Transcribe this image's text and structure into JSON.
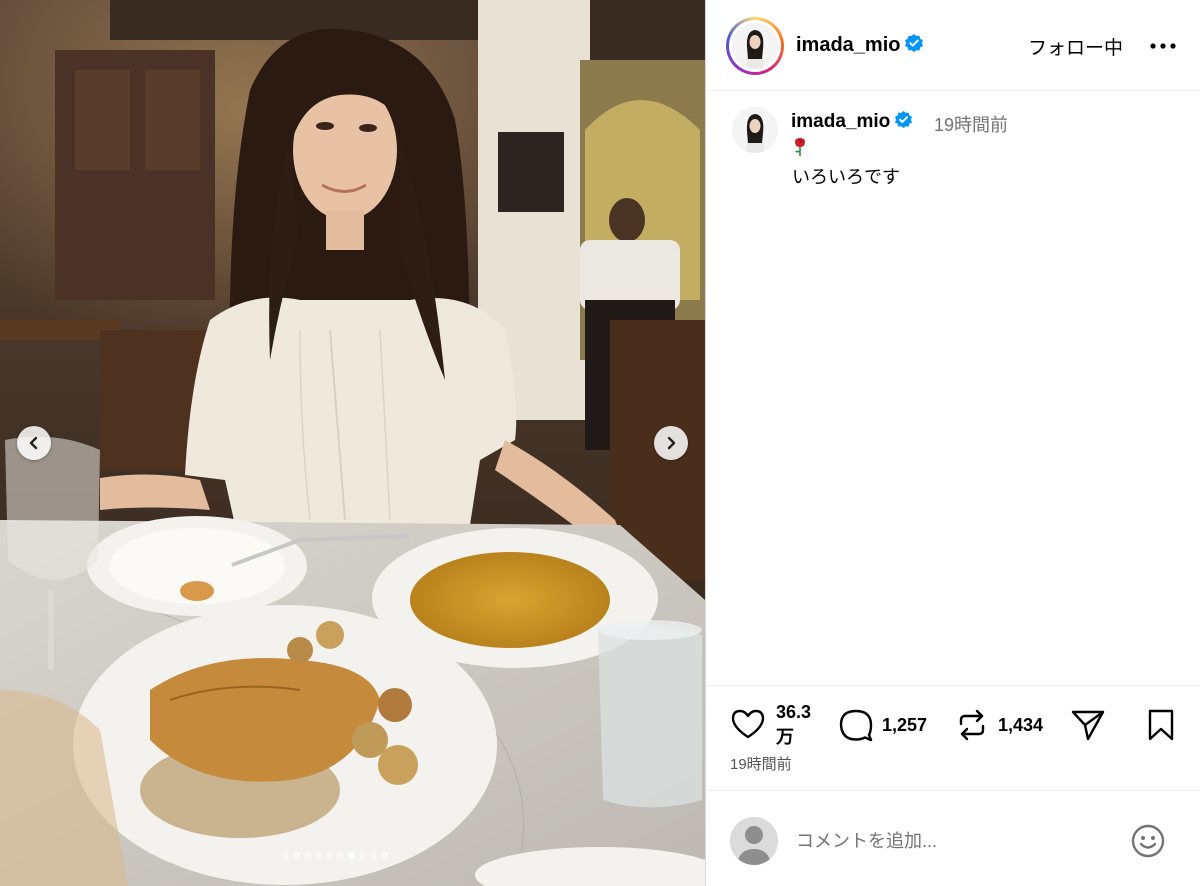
{
  "post": {
    "username": "imada_mio",
    "follow_label": "フォロー中",
    "caption_username": "imada_mio",
    "caption_time": "19時間前",
    "caption_emoji": "rose-icon",
    "caption_text": "いろいろです",
    "likes": "36.3",
    "likes_unit": "万",
    "comments": "1,257",
    "reposts": "1,434",
    "post_time": "19時間前",
    "comment_placeholder": "コメントを追加...",
    "carousel_total": 10,
    "carousel_active": 7
  },
  "colors": {
    "verified": "#0095f6",
    "secondary_text": "#737373",
    "border": "#dbdbdb"
  },
  "icons": [
    "more-icon",
    "heart-icon",
    "comment-icon",
    "repost-icon",
    "share-icon",
    "bookmark-icon",
    "emoji-icon",
    "chevron-left-icon",
    "chevron-right-icon",
    "verified-badge-icon"
  ]
}
